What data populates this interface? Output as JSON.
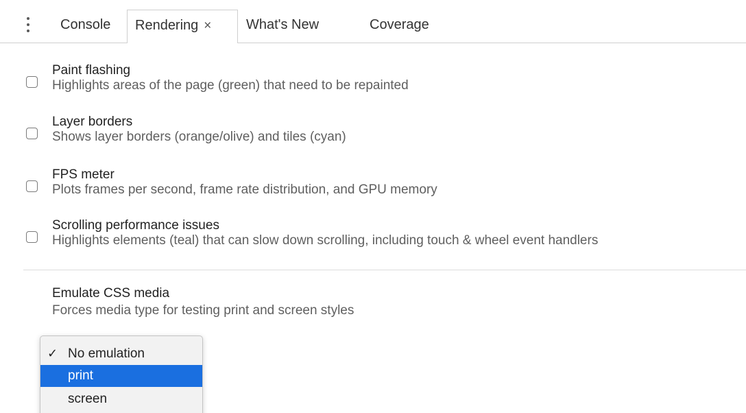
{
  "tabs": [
    {
      "label": "Console",
      "active": false
    },
    {
      "label": "Rendering",
      "active": true,
      "close_glyph": "×"
    },
    {
      "label": "What's New",
      "active": false
    },
    {
      "label": "Coverage",
      "active": false
    }
  ],
  "options": [
    {
      "title": "Paint flashing",
      "description": "Highlights areas of the page (green) that need to be repainted",
      "checked": false
    },
    {
      "title": "Layer borders",
      "description": "Shows layer borders (orange/olive) and tiles (cyan)",
      "checked": false
    },
    {
      "title": "FPS meter",
      "description": "Plots frames per second, frame rate distribution, and GPU memory",
      "checked": false
    },
    {
      "title": "Scrolling performance issues",
      "description": "Highlights elements (teal) that can slow down scrolling, including touch & wheel event handlers",
      "checked": false
    }
  ],
  "emulate_media": {
    "title": "Emulate CSS media",
    "description": "Forces media type for testing print and screen styles",
    "selected": "No emulation",
    "highlighted": "print",
    "options": [
      {
        "label": "No emulation",
        "check_glyph": "✓"
      },
      {
        "label": "print",
        "check_glyph": ""
      },
      {
        "label": "screen",
        "check_glyph": ""
      }
    ]
  },
  "icons": {
    "menu": "more-vertical-icon",
    "close": "close-icon",
    "check": "checkmark-icon"
  },
  "colors": {
    "highlight": "#1a6fe0",
    "description_text": "#5f5f5f",
    "border": "#cfcfcf"
  }
}
